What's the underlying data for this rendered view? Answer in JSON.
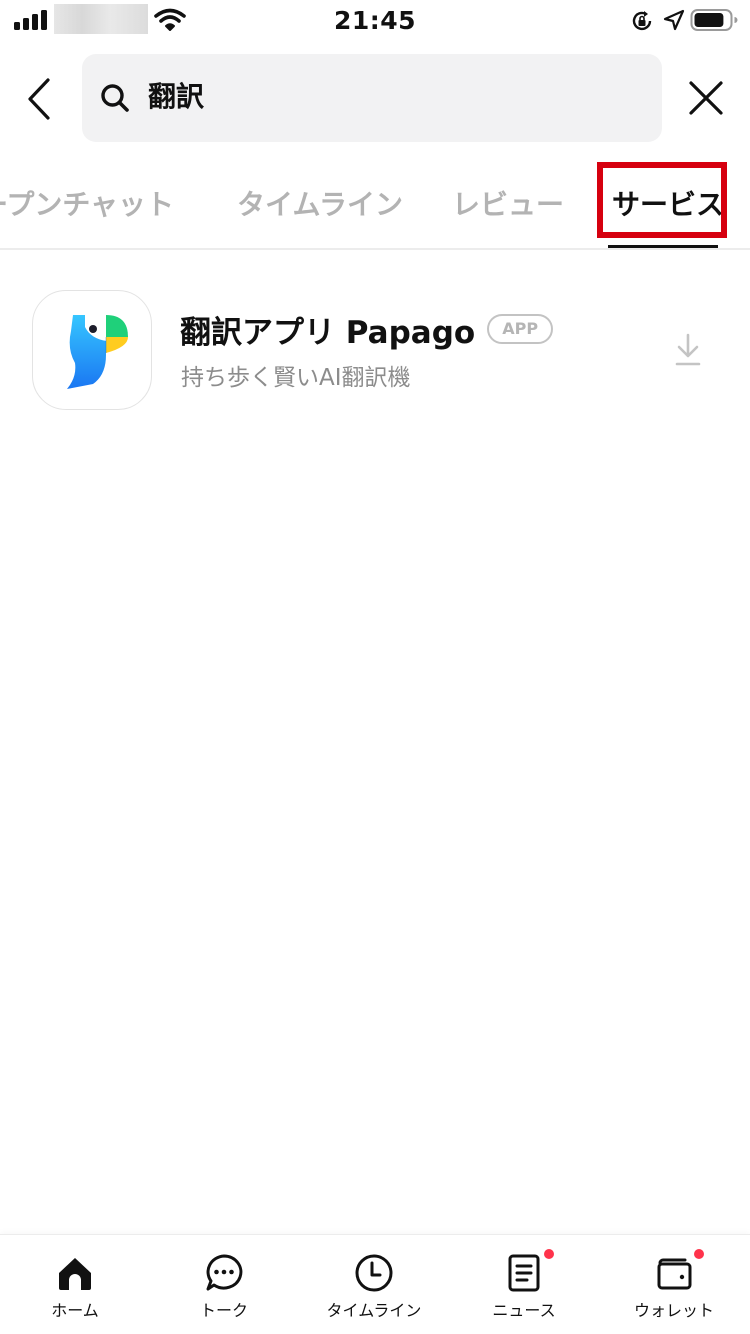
{
  "status_bar": {
    "time": "21:45",
    "signal_icon": "cellular-signal-icon",
    "wifi_icon": "wifi-icon",
    "rotation_lock_icon": "rotation-lock-icon",
    "location_icon": "location-arrow-icon",
    "battery_icon": "battery-icon",
    "battery_level": 0.85
  },
  "search": {
    "back_icon": "chevron-left-icon",
    "search_icon": "search-icon",
    "query": "翻訳",
    "clear_icon": "close-icon"
  },
  "tabs": [
    {
      "label": "ープンチャット",
      "active": false
    },
    {
      "label": "タイムライン",
      "active": false
    },
    {
      "label": "レビュー",
      "active": false
    },
    {
      "label": "サービス",
      "active": true
    }
  ],
  "highlight_color": "#d6000f",
  "results": [
    {
      "title": "翻訳アプリ Papago",
      "badge": "APP",
      "description": "持ち歩く賢いAI翻訳機",
      "icon": "papago-parrot-icon",
      "action_icon": "download-icon"
    }
  ],
  "bottom_nav": [
    {
      "label": "ホーム",
      "icon": "home-icon",
      "badge_dot": false
    },
    {
      "label": "トーク",
      "icon": "chat-bubble-icon",
      "badge_dot": false
    },
    {
      "label": "タイムライン",
      "icon": "clock-icon",
      "badge_dot": false
    },
    {
      "label": "ニュース",
      "icon": "news-icon",
      "badge_dot": true
    },
    {
      "label": "ウォレット",
      "icon": "wallet-icon",
      "badge_dot": true
    }
  ],
  "badge_dot_color": "#ff334b"
}
